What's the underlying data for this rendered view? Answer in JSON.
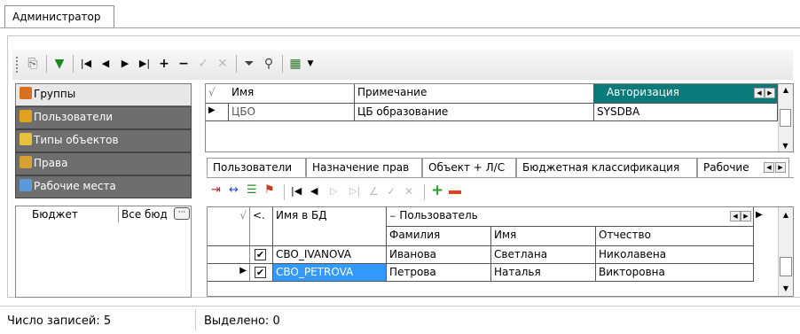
{
  "window": {
    "tab_label": "Администратор"
  },
  "toolbar": {
    "icons": [
      "copy-icon",
      "filter-down-icon",
      "first-icon",
      "prev-icon",
      "next-icon",
      "last-icon",
      "add-icon",
      "remove-icon",
      "confirm-icon",
      "cancel-icon",
      "funnel-icon",
      "binoculars-icon",
      "table-export-icon"
    ]
  },
  "sidebar": {
    "items": [
      {
        "label": "Группы",
        "icon": "groups-icon"
      },
      {
        "label": "Пользователи",
        "icon": "users-icon"
      },
      {
        "label": "Типы объектов",
        "icon": "object-types-icon"
      },
      {
        "label": "Права",
        "icon": "rights-icon"
      },
      {
        "label": "Рабочие места",
        "icon": "workplaces-icon"
      }
    ],
    "budget": {
      "label": "Бюджет",
      "value": "Все бюд",
      "more": "···"
    }
  },
  "groups_grid": {
    "headers": {
      "name": "Имя",
      "note": "Примечание",
      "auth": "Авторизация"
    },
    "rows": [
      {
        "name": "ЦБО",
        "note": "ЦБ образование",
        "auth": "SYSDBA"
      }
    ]
  },
  "detail_tabs": [
    "Пользователи",
    "Назначение прав",
    "Объект + Л/С",
    "Бюджетная классификация",
    "Рабочие"
  ],
  "users_grid": {
    "headers": {
      "col": "<.",
      "db_name": "Имя в БД",
      "user": "Пользователь",
      "last": "Фамилия",
      "first": "Имя",
      "middle": "Отчество"
    },
    "rows": [
      {
        "checked": "✔",
        "db_name": "CBO_IVANOVA",
        "last": "Иванова",
        "first": "Светлана",
        "middle": "Николавена"
      },
      {
        "checked": "✔",
        "db_name": "CBO_PETROVA",
        "last": "Петрова",
        "first": "Наталья",
        "middle": "Викторовна"
      }
    ]
  },
  "status": {
    "records_label": "Число записей:",
    "records_value": "5",
    "selected_label": "Выделено:",
    "selected_value": "0"
  },
  "colors": {
    "header_teal": "#0a7a7a",
    "selected_blue": "#3399ff",
    "sidebar_gray": "#6e6e6e"
  }
}
